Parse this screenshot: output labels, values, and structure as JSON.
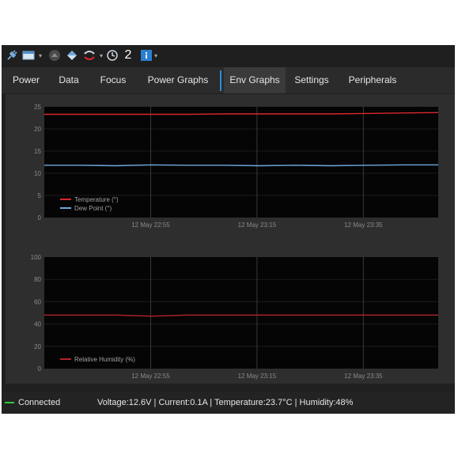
{
  "toolbar": {
    "icons": [
      "plug-icon",
      "window-icon",
      "dropdown-arrow",
      "eject-icon",
      "diamond-icon",
      "arrows-icon",
      "clock-icon",
      "info-icon"
    ],
    "counter": "2"
  },
  "tabs": [
    {
      "label": "Power"
    },
    {
      "label": "Data"
    },
    {
      "label": "Focus"
    },
    {
      "label": "Power Graphs"
    },
    {
      "label": "Env Graphs",
      "active": true
    },
    {
      "label": "Settings"
    },
    {
      "label": "Peripherals"
    }
  ],
  "chart_data": [
    {
      "type": "line",
      "title": "",
      "xlabel": "",
      "ylabel": "",
      "ylim": [
        0,
        25
      ],
      "yticks": [
        "25",
        "20",
        "15",
        "10",
        "5",
        "0"
      ],
      "xticks": [
        "12 May 22:55",
        "12 May 23:15",
        "12 May 23:35"
      ],
      "grid": true,
      "legend_position": "bottom-left",
      "series": [
        {
          "name": "Temperature (°)",
          "color": "#d9262b",
          "values": [
            23.3,
            23.3,
            23.3,
            23.3,
            23.3,
            23.4,
            23.4,
            23.4,
            23.4,
            23.5,
            23.6,
            23.7
          ]
        },
        {
          "name": "Dew Point (°)",
          "color": "#6fa8dc",
          "values": [
            11.8,
            11.8,
            11.7,
            11.9,
            11.8,
            11.8,
            11.7,
            11.8,
            11.7,
            11.8,
            11.9,
            11.9
          ]
        }
      ]
    },
    {
      "type": "line",
      "title": "",
      "xlabel": "",
      "ylabel": "",
      "ylim": [
        0,
        100
      ],
      "yticks": [
        "100",
        "80",
        "60",
        "40",
        "20",
        "0"
      ],
      "xticks": [
        "12 May 22:55",
        "12 May 23:15",
        "12 May 23:35"
      ],
      "grid": true,
      "legend_position": "bottom-left",
      "series": [
        {
          "name": "Relative Humidity (%)",
          "color": "#b3232a",
          "values": [
            48,
            48,
            48,
            47,
            48,
            48,
            48,
            48,
            48,
            48,
            48,
            48
          ]
        }
      ]
    }
  ],
  "status": {
    "connection": "Connected",
    "connection_color": "#2ecc40",
    "readout": "Voltage:12.6V |  Current:0.1A |  Temperature:23.7°C |  Humidity:48%"
  }
}
